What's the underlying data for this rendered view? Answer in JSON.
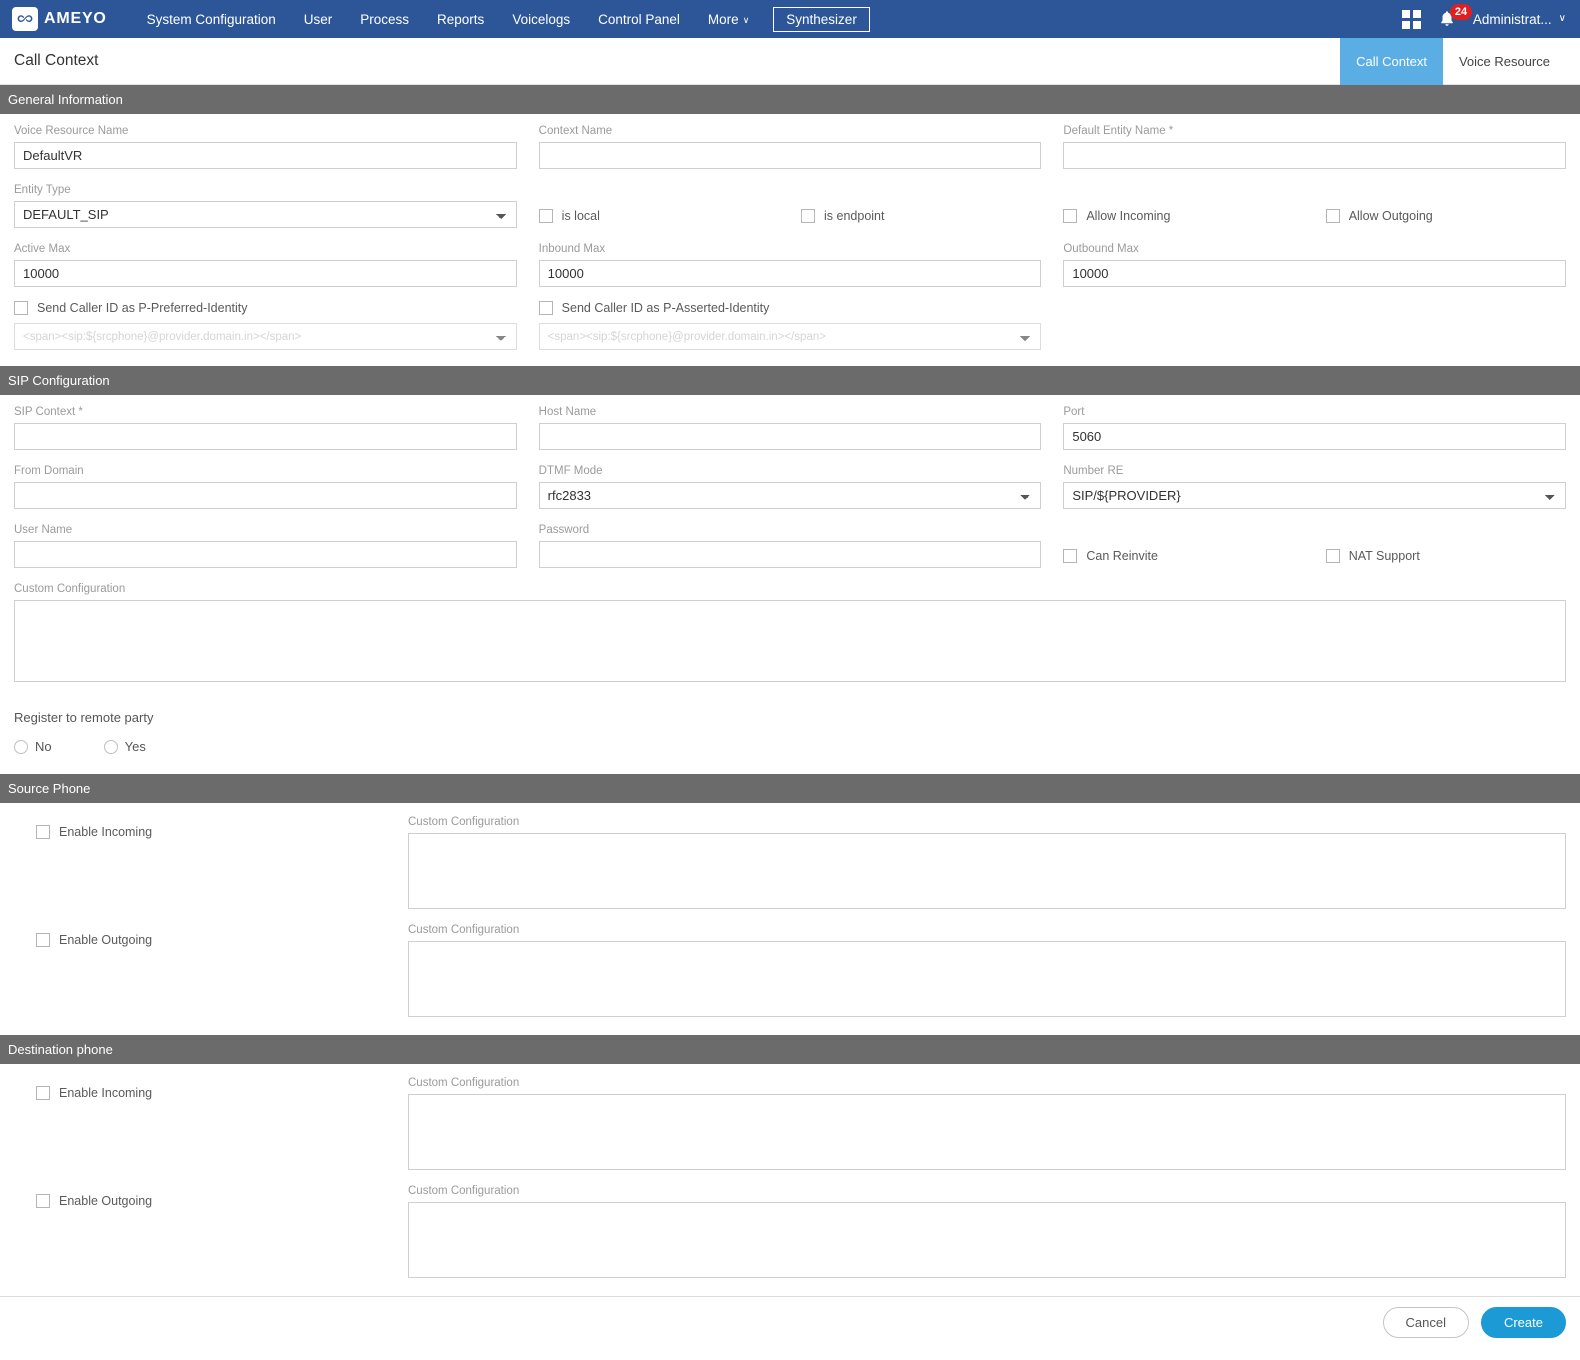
{
  "navbar": {
    "brand": "AMEYO",
    "brand_icon": "infinity-logo-icon",
    "items": [
      {
        "label": "System Configuration",
        "caret": false
      },
      {
        "label": "User",
        "caret": false
      },
      {
        "label": "Process",
        "caret": false
      },
      {
        "label": "Reports",
        "caret": false
      },
      {
        "label": "Voicelogs",
        "caret": false
      },
      {
        "label": "Control Panel",
        "caret": false
      },
      {
        "label": "More",
        "caret": true
      }
    ],
    "more_caret": "∨",
    "action_button": "Synthesizer",
    "grid_icon": "apps-grid-icon",
    "bell_icon": "bell-icon",
    "notification_count": "24",
    "user_label": "Administrat...",
    "user_caret": "∨",
    "background_color": "#2c5697"
  },
  "page": {
    "title": "Call Context",
    "tabs": [
      {
        "label": "Call Context",
        "active": true
      },
      {
        "label": "Voice Resource",
        "active": false
      }
    ],
    "active_tab_color": "#5aaee4"
  },
  "general_information": {
    "header": "General Information",
    "voice_resource_name": {
      "label": "Voice Resource Name",
      "value": "DefaultVR",
      "placeholder": ""
    },
    "context_name": {
      "label": "Context Name",
      "value": "",
      "placeholder": ""
    },
    "default_entity_name": {
      "label": "Default Entity Name *",
      "value": "",
      "placeholder": ""
    },
    "entity_type": {
      "label": "Entity Type",
      "value": "DEFAULT_SIP",
      "options": [
        "DEFAULT_SIP"
      ]
    },
    "is_local": {
      "label": "is local",
      "checked": false
    },
    "is_endpoint": {
      "label": "is endpoint",
      "checked": false
    },
    "allow_incoming": {
      "label": "Allow Incoming",
      "checked": false
    },
    "allow_outgoing": {
      "label": "Allow Outgoing",
      "checked": false
    },
    "active_max": {
      "label": "Active Max",
      "value": "10000"
    },
    "inbound_max": {
      "label": "Inbound Max",
      "value": "10000"
    },
    "outbound_max": {
      "label": "Outbound Max",
      "value": "10000"
    },
    "p_preferred": {
      "label": "Send Caller ID as P-Preferred-Identity",
      "checked": false,
      "select_value": "<span><sip:${srcphone}@provider.domain.in></span>"
    },
    "p_asserted": {
      "label": "Send Caller ID as P-Asserted-Identity",
      "checked": false,
      "select_value": "<span><sip:${srcphone}@provider.domain.in></span>"
    }
  },
  "sip_configuration": {
    "header": "SIP Configuration",
    "sip_context": {
      "label": "SIP Context *",
      "value": ""
    },
    "host_name": {
      "label": "Host Name",
      "value": ""
    },
    "port": {
      "label": "Port",
      "value": "5060"
    },
    "from_domain": {
      "label": "From Domain",
      "value": ""
    },
    "dtmf_mode": {
      "label": "DTMF Mode",
      "value": "rfc2833",
      "options": [
        "rfc2833"
      ]
    },
    "number_re": {
      "label": "Number RE",
      "value": "SIP/${PROVIDER}",
      "options": [
        "SIP/${PROVIDER}"
      ]
    },
    "user_name": {
      "label": "User Name",
      "value": ""
    },
    "password": {
      "label": "Password",
      "value": ""
    },
    "can_reinvite": {
      "label": "Can Reinvite",
      "checked": false
    },
    "nat_support": {
      "label": "NAT Support",
      "checked": false
    },
    "custom_configuration": {
      "label": "Custom Configuration",
      "value": ""
    }
  },
  "register_remote": {
    "title": "Register to remote party",
    "options": [
      {
        "label": "No",
        "selected": false
      },
      {
        "label": "Yes",
        "selected": false
      }
    ]
  },
  "source_phone": {
    "header": "Source Phone",
    "incoming": {
      "label": "Enable Incoming",
      "checked": false,
      "config_label": "Custom Configuration",
      "config_value": ""
    },
    "outgoing": {
      "label": "Enable Outgoing",
      "checked": false,
      "config_label": "Custom Configuration",
      "config_value": ""
    }
  },
  "destination_phone": {
    "header": "Destination phone",
    "incoming": {
      "label": "Enable Incoming",
      "checked": false,
      "config_label": "Custom Configuration",
      "config_value": ""
    },
    "outgoing": {
      "label": "Enable Outgoing",
      "checked": false,
      "config_label": "Custom Configuration",
      "config_value": ""
    }
  },
  "footer": {
    "cancel_label": "Cancel",
    "create_label": "Create",
    "create_color": "#1b9ad6"
  }
}
